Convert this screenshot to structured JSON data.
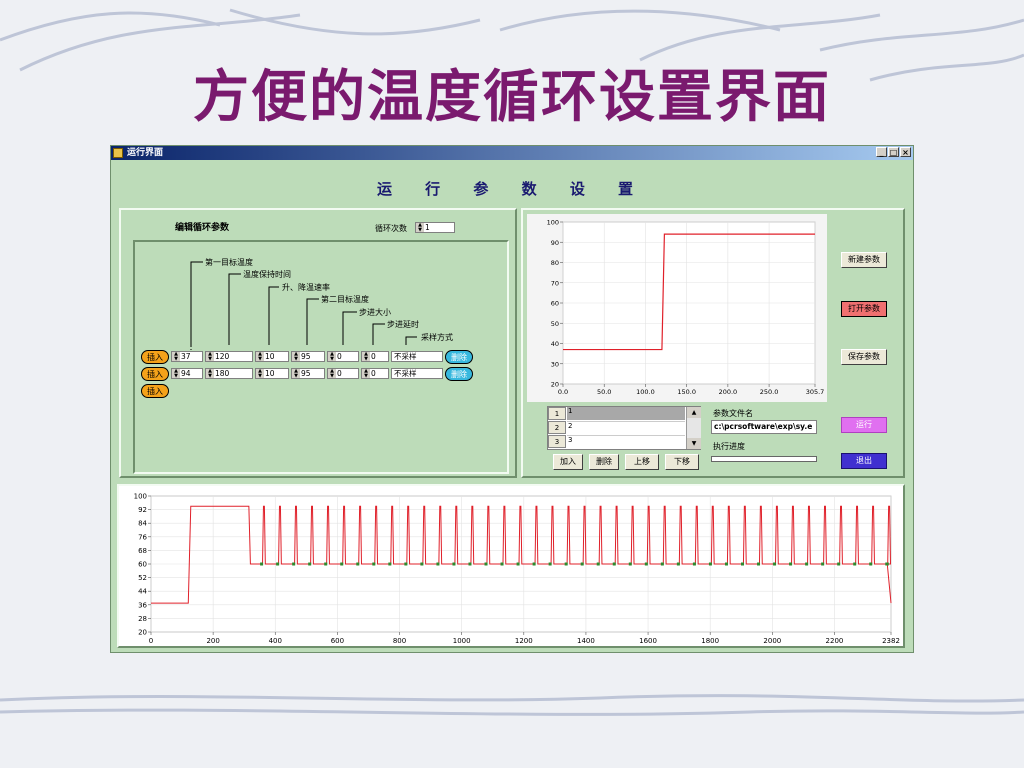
{
  "slide": {
    "title": "方便的温度循环设置界面"
  },
  "window": {
    "title": "运行界面",
    "buttons": [
      "_",
      "□",
      "×"
    ],
    "heading": "运 行 参 数 设 置"
  },
  "edit_panel": {
    "title": "编辑循环参数",
    "cycle_label": "循环次数",
    "cycle_value": "1",
    "column_labels": [
      "第一目标温度",
      "温度保持时间",
      "升、降温速率",
      "第二目标温度",
      "步进大小",
      "步进延时",
      "采样方式"
    ],
    "rows": [
      {
        "insert": "插入",
        "values": [
          "37",
          "120",
          "10",
          "95",
          "0",
          "0",
          "不采样"
        ],
        "delete": "删除"
      },
      {
        "insert": "插入",
        "values": [
          "94",
          "180",
          "10",
          "95",
          "0",
          "0",
          "不采样"
        ],
        "delete": "删除"
      }
    ],
    "extra_insert": "插入"
  },
  "right_panel": {
    "steps": [
      {
        "num": "1",
        "value": "1"
      },
      {
        "num": "2",
        "value": "2"
      },
      {
        "num": "3",
        "value": "3"
      }
    ],
    "list_buttons": [
      "加入",
      "删除",
      "上移",
      "下移"
    ],
    "file_label": "参数文件名",
    "file_value": "c:\\pcrsoftware\\exp\\sy.e",
    "progress_label": "执行进度",
    "progress_fraction": 0.0,
    "side_buttons": {
      "new": "新建参数",
      "open": "打开参数",
      "save": "保存参数",
      "run": "运行",
      "exit": "退出"
    }
  },
  "colors": {
    "line": "#e0202a",
    "point": "#2e8b2e",
    "open_button": "#f07070",
    "run_button": "#e070f0",
    "exit_button": "#4030d0"
  },
  "chart_data": [
    {
      "type": "line",
      "x_ticks": [
        "0.0",
        "50.0",
        "100.0",
        "150.0",
        "200.0",
        "250.0",
        "305.7"
      ],
      "y_ticks": [
        "20",
        "30",
        "40",
        "50",
        "60",
        "70",
        "80",
        "90",
        "100"
      ],
      "xlim": [
        0,
        305.7
      ],
      "ylim": [
        20,
        100
      ],
      "grid": true,
      "series": [
        {
          "x": [
            0,
            120,
            123,
            305.7
          ],
          "values": [
            37,
            37,
            94,
            94
          ]
        }
      ]
    },
    {
      "type": "line",
      "x_ticks": [
        "0",
        "200",
        "400",
        "600",
        "800",
        "1000",
        "1200",
        "1400",
        "1600",
        "1800",
        "2000",
        "2200",
        "2382"
      ],
      "y_ticks": [
        "20",
        "28",
        "36",
        "44",
        "52",
        "60",
        "68",
        "76",
        "84",
        "92",
        "100"
      ],
      "xlim": [
        0,
        2382
      ],
      "ylim": [
        20,
        100
      ],
      "grid": true,
      "levels": {
        "start": 37,
        "hold": 94,
        "base": 60,
        "peak": 94,
        "end": 37
      },
      "segments": {
        "start_end": 120,
        "hold_end": 315,
        "peak_first": 362,
        "peak_spacing": 51.6,
        "peak_count": 40,
        "finish": 2370
      }
    }
  ]
}
